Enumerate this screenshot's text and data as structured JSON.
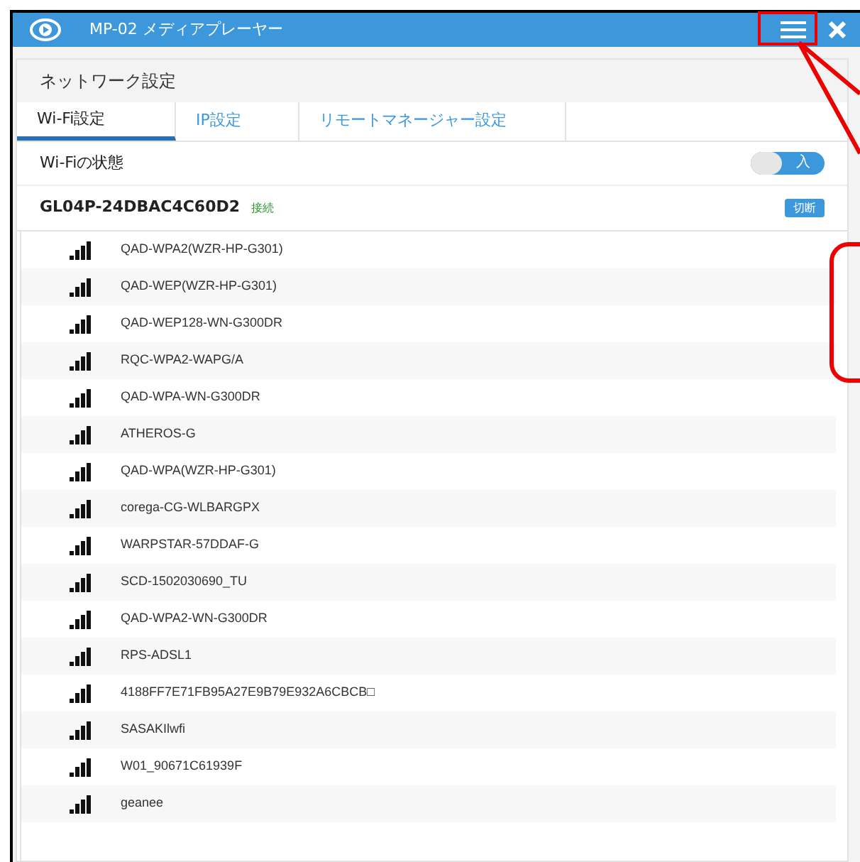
{
  "window": {
    "title": "MP-02 メディアプレーヤー"
  },
  "section_title": "ネットワーク設定",
  "tabs": [
    {
      "label": "Wi-Fi設定",
      "selected": true
    },
    {
      "label": "IP設定",
      "selected": false
    },
    {
      "label": "リモートマネージャー設定",
      "selected": false
    }
  ],
  "wifi_status": {
    "label": "Wi-Fiの状態",
    "on": true,
    "toggle_label": "入"
  },
  "connected": {
    "ssid": "GL04P-24DBAC4C60D2",
    "status": "接続",
    "button": "切断"
  },
  "networks": [
    {
      "ssid": "QAD-WPA2(WZR-HP-G301)"
    },
    {
      "ssid": "QAD-WEP(WZR-HP-G301)"
    },
    {
      "ssid": "QAD-WEP128-WN-G300DR"
    },
    {
      "ssid": "RQC-WPA2-WAPG/A"
    },
    {
      "ssid": "QAD-WPA-WN-G300DR"
    },
    {
      "ssid": "ATHEROS-G"
    },
    {
      "ssid": "QAD-WPA(WZR-HP-G301)"
    },
    {
      "ssid": "corega-CG-WLBARGPX"
    },
    {
      "ssid": "WARPSTAR-57DDAF-G"
    },
    {
      "ssid": "SCD-1502030690_TU"
    },
    {
      "ssid": "QAD-WPA2-WN-G300DR"
    },
    {
      "ssid": "RPS-ADSL1"
    },
    {
      "ssid": "4188FF7E71FB95A27E9B79E932A6CBCB□"
    },
    {
      "ssid": "SASAKIlwfi"
    },
    {
      "ssid": "W01_90671C61939F"
    },
    {
      "ssid": "geanee"
    }
  ]
}
